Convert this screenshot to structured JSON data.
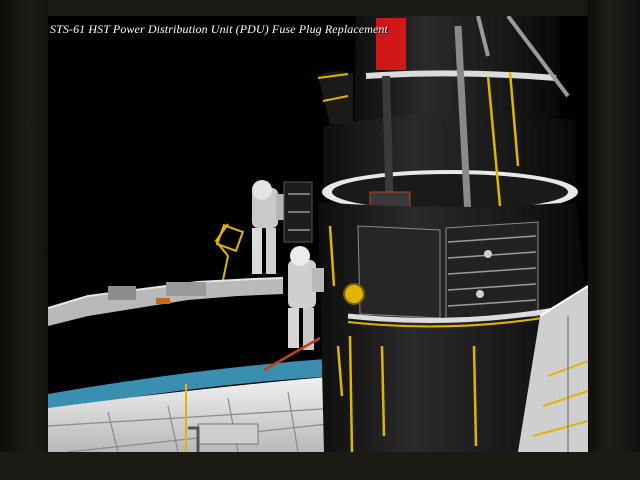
{
  "caption": "STS-61 HST Power Distribution Unit (PDU) Fuse Plug Replacement",
  "colors": {
    "space": "#000000",
    "telescope_body": "#1c1c1c",
    "handrail": "#e0b400",
    "foil_band": "#dcdcdc",
    "earth_limb": "#3a8fb0",
    "red_marker": "#d01818"
  }
}
